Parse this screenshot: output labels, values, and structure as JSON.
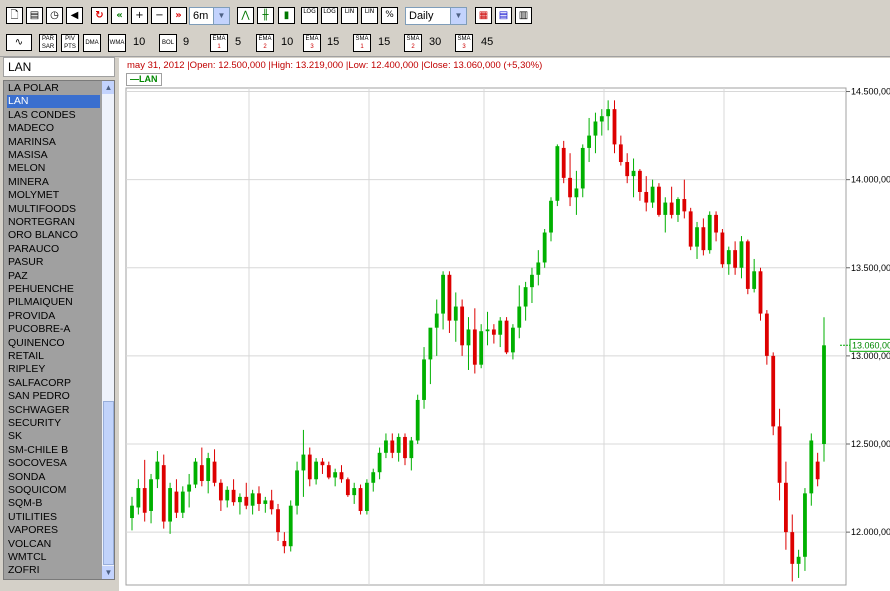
{
  "toolbar": {
    "period_value": "6m",
    "interval_value": "Daily",
    "buttons": {
      "new": "🗋",
      "save": "▤",
      "clock": "◷",
      "sound": "◀",
      "refresh": "↻",
      "back": "«",
      "zoom_in": "+",
      "zoom_out": "−",
      "forward": "»",
      "line": "⋀",
      "ohlc": "╫",
      "candle": "▮",
      "log1": "LOG",
      "log2": "LOG",
      "lin1": "LIN",
      "lin2": "LIN",
      "pct": "%",
      "compare": "▦",
      "colors": "▤",
      "grid": "▥"
    }
  },
  "indicators": {
    "par_sar": "PAR SAR",
    "piv_pts": "PIV PTS",
    "dma": "DMA",
    "wma": "WMA",
    "wma_value": "10",
    "bol": "BOL",
    "bol_value": "9",
    "ema1": "EMA",
    "ema1_n": "1",
    "ema1_value": "5",
    "ema2": "EMA",
    "ema2_n": "2",
    "ema2_value": "10",
    "ema3": "EMA",
    "ema3_n": "3",
    "ema3_value": "15",
    "sma1": "SMA",
    "sma1_n": "1",
    "sma1_value": "15",
    "sma2": "SMA",
    "sma2_n": "2",
    "sma2_value": "30",
    "sma3": "SMA",
    "sma3_n": "3",
    "sma3_value": "45"
  },
  "symbol_header": "LAN",
  "symbols": [
    "LA POLAR",
    "LAN",
    "LAS CONDES",
    "MADECO",
    "MARINSA",
    "MASISA",
    "MELON",
    "MINERA",
    "MOLYMET",
    "MULTIFOODS",
    "NORTEGRAN",
    "ORO BLANCO",
    "PARAUCO",
    "PASUR",
    "PAZ",
    "PEHUENCHE",
    "PILMAIQUEN",
    "PROVIDA",
    "PUCOBRE-A",
    "QUINENCO",
    "RETAIL",
    "RIPLEY",
    "SALFACORP",
    "SAN PEDRO",
    "SCHWAGER",
    "SECURITY",
    "SK",
    "SM-CHILE B",
    "SOCOVESA",
    "SONDA",
    "SOQUICOM",
    "SQM-B",
    "UTILITIES",
    "VAPORES",
    "VOLCAN",
    "WMTCL",
    "ZOFRI"
  ],
  "selected_symbol": "LAN",
  "chart": {
    "ohlc_text": "may 31, 2012 |Open: 12.500,000 |High: 13.219,000 |Low: 12.400,000 |Close: 13.060,000 (+5,30%)",
    "legend_label": "LAN",
    "last_price_label": "13.060,00",
    "up_color": "#00b000",
    "down_color": "#dd0000"
  },
  "chart_data": {
    "type": "candlestick",
    "title": "",
    "ylim": [
      11700,
      14520
    ],
    "yticks": [
      12000,
      12500,
      13000,
      13500,
      14000,
      14500
    ],
    "ytick_labels": [
      "12.000,00",
      "12.500,00",
      "13.000,00",
      "13.500,00",
      "14.000,00",
      "14.500,00"
    ],
    "grid": true,
    "series": [
      {
        "name": "LAN",
        "ohlc": [
          [
            12080,
            12200,
            12010,
            12150
          ],
          [
            12140,
            12300,
            12100,
            12250
          ],
          [
            12250,
            12410,
            12060,
            12110
          ],
          [
            12120,
            12330,
            12050,
            12300
          ],
          [
            12300,
            12460,
            12250,
            12400
          ],
          [
            12380,
            12440,
            12020,
            12060
          ],
          [
            12060,
            12280,
            11990,
            12250
          ],
          [
            12230,
            12300,
            12080,
            12110
          ],
          [
            12110,
            12260,
            12080,
            12230
          ],
          [
            12230,
            12330,
            12140,
            12270
          ],
          [
            12270,
            12420,
            12250,
            12400
          ],
          [
            12380,
            12480,
            12260,
            12290
          ],
          [
            12290,
            12450,
            12220,
            12420
          ],
          [
            12400,
            12470,
            12260,
            12280
          ],
          [
            12280,
            12300,
            12120,
            12180
          ],
          [
            12180,
            12260,
            12140,
            12240
          ],
          [
            12240,
            12300,
            12150,
            12170
          ],
          [
            12170,
            12220,
            12100,
            12200
          ],
          [
            12200,
            12280,
            12130,
            12150
          ],
          [
            12150,
            12240,
            12100,
            12220
          ],
          [
            12220,
            12260,
            12120,
            12160
          ],
          [
            12160,
            12200,
            12110,
            12180
          ],
          [
            12180,
            12240,
            12100,
            12130
          ],
          [
            12130,
            12160,
            11950,
            12000
          ],
          [
            11950,
            12000,
            11880,
            11920
          ],
          [
            11920,
            12180,
            11890,
            12150
          ],
          [
            12150,
            12400,
            12100,
            12350
          ],
          [
            12350,
            12580,
            12200,
            12440
          ],
          [
            12440,
            12480,
            12260,
            12300
          ],
          [
            12300,
            12420,
            12270,
            12400
          ],
          [
            12400,
            12420,
            12330,
            12380
          ],
          [
            12380,
            12400,
            12300,
            12310
          ],
          [
            12310,
            12360,
            12260,
            12340
          ],
          [
            12340,
            12380,
            12280,
            12300
          ],
          [
            12300,
            12310,
            12200,
            12210
          ],
          [
            12210,
            12280,
            12160,
            12250
          ],
          [
            12250,
            12270,
            12100,
            12120
          ],
          [
            12120,
            12300,
            12100,
            12280
          ],
          [
            12280,
            12360,
            12230,
            12340
          ],
          [
            12340,
            12480,
            12300,
            12450
          ],
          [
            12450,
            12560,
            12420,
            12520
          ],
          [
            12520,
            12560,
            12420,
            12450
          ],
          [
            12450,
            12560,
            12400,
            12540
          ],
          [
            12540,
            12560,
            12380,
            12420
          ],
          [
            12420,
            12540,
            12350,
            12520
          ],
          [
            12520,
            12780,
            12500,
            12750
          ],
          [
            12750,
            13050,
            12700,
            12980
          ],
          [
            12980,
            13150,
            12840,
            13160
          ],
          [
            13160,
            13320,
            13000,
            13240
          ],
          [
            13240,
            13480,
            13150,
            13460
          ],
          [
            13460,
            13480,
            13130,
            13200
          ],
          [
            13200,
            13360,
            13080,
            13280
          ],
          [
            13280,
            13320,
            13000,
            13060
          ],
          [
            13060,
            13220,
            12920,
            13150
          ],
          [
            13150,
            13270,
            12900,
            12950
          ],
          [
            12950,
            13180,
            12930,
            13140
          ],
          [
            13140,
            13250,
            13060,
            13150
          ],
          [
            13150,
            13180,
            13070,
            13120
          ],
          [
            13120,
            13220,
            13050,
            13200
          ],
          [
            13200,
            13220,
            13010,
            13020
          ],
          [
            13020,
            13180,
            12980,
            13160
          ],
          [
            13160,
            13400,
            13100,
            13280
          ],
          [
            13280,
            13420,
            13200,
            13390
          ],
          [
            13390,
            13500,
            13300,
            13460
          ],
          [
            13460,
            13600,
            13400,
            13530
          ],
          [
            13530,
            13720,
            13500,
            13700
          ],
          [
            13700,
            13900,
            13650,
            13880
          ],
          [
            13880,
            14200,
            13850,
            14190
          ],
          [
            14180,
            14220,
            13980,
            14010
          ],
          [
            14010,
            14150,
            13850,
            13900
          ],
          [
            13900,
            14050,
            13800,
            13950
          ],
          [
            13950,
            14200,
            13900,
            14180
          ],
          [
            14180,
            14350,
            14100,
            14250
          ],
          [
            14250,
            14380,
            14150,
            14330
          ],
          [
            14330,
            14400,
            14250,
            14360
          ],
          [
            14360,
            14450,
            14280,
            14400
          ],
          [
            14400,
            14450,
            14150,
            14200
          ],
          [
            14200,
            14250,
            14080,
            14100
          ],
          [
            14100,
            14150,
            13980,
            14020
          ],
          [
            14020,
            14120,
            13900,
            14050
          ],
          [
            14050,
            14060,
            13880,
            13930
          ],
          [
            13930,
            14020,
            13820,
            13870
          ],
          [
            13870,
            14000,
            13840,
            13960
          ],
          [
            13960,
            13980,
            13790,
            13800
          ],
          [
            13800,
            13900,
            13700,
            13870
          ],
          [
            13870,
            13960,
            13780,
            13800
          ],
          [
            13800,
            13900,
            13760,
            13890
          ],
          [
            13890,
            14000,
            13780,
            13820
          ],
          [
            13820,
            13840,
            13600,
            13620
          ],
          [
            13620,
            13760,
            13550,
            13730
          ],
          [
            13730,
            13780,
            13570,
            13600
          ],
          [
            13600,
            13820,
            13580,
            13800
          ],
          [
            13800,
            13820,
            13650,
            13700
          ],
          [
            13700,
            13720,
            13500,
            13520
          ],
          [
            13520,
            13620,
            13460,
            13600
          ],
          [
            13600,
            13650,
            13460,
            13500
          ],
          [
            13500,
            13680,
            13440,
            13650
          ],
          [
            13650,
            13660,
            13350,
            13380
          ],
          [
            13380,
            13550,
            13360,
            13480
          ],
          [
            13480,
            13500,
            13200,
            13240
          ],
          [
            13240,
            13260,
            12950,
            13000
          ],
          [
            13000,
            13020,
            12550,
            12600
          ],
          [
            12600,
            12700,
            12180,
            12280
          ],
          [
            12280,
            12400,
            11900,
            12000
          ],
          [
            12000,
            12100,
            11720,
            11820
          ],
          [
            11820,
            11900,
            11740,
            11860
          ],
          [
            11860,
            12250,
            11780,
            12220
          ],
          [
            12220,
            12560,
            12150,
            12520
          ],
          [
            12400,
            12450,
            12260,
            12300
          ],
          [
            12500,
            13219,
            12400,
            13060
          ]
        ]
      }
    ]
  }
}
